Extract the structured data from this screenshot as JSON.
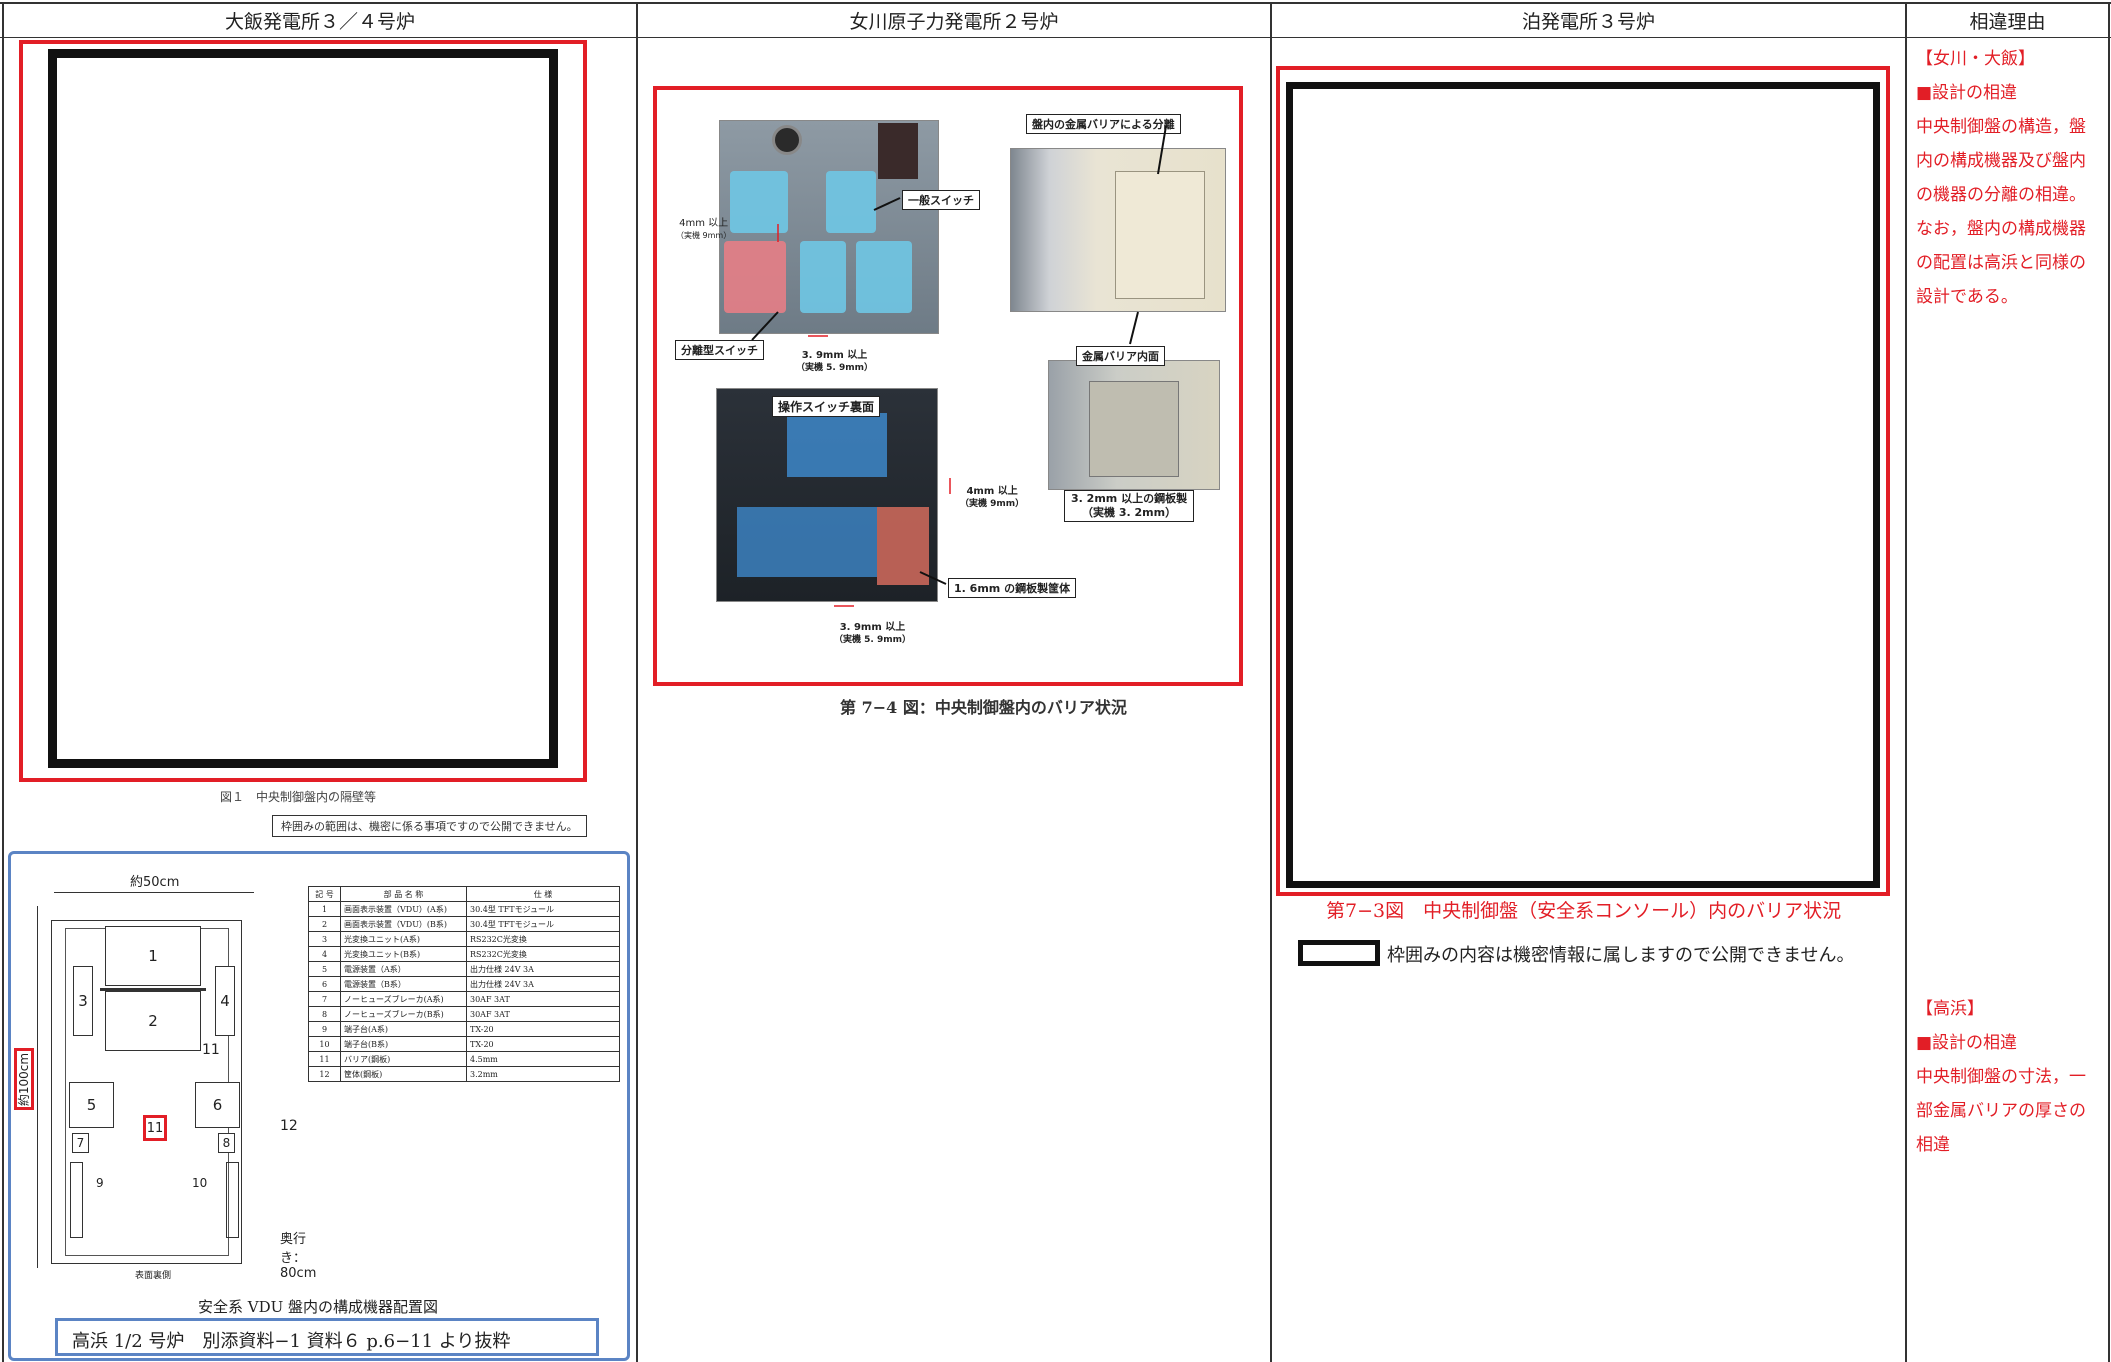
{
  "headers": {
    "col1": "大飯発電所３／４号炉",
    "col2": "女川原子力発電所２号炉",
    "col3": "泊発電所３号炉",
    "col4": "相違理由"
  },
  "col1": {
    "fig1_caption": "図１　中央制御盤内の隔壁等",
    "confidential_note": "枠囲みの範囲は、機密に係る事項ですので公開できません。",
    "layout": {
      "width_label": "約50cm",
      "height_label": "約100cm",
      "depth_label": "奥行き：80cm",
      "front_label": "表面裏側",
      "numbers": [
        "1",
        "2",
        "3",
        "4",
        "5",
        "6",
        "7",
        "8",
        "9",
        "10",
        "11",
        "12"
      ],
      "caption": "安全系 VDU 盤内の構成機器配置図",
      "source": "高浜 1/2 号炉　別添資料−1  資料６ p.6−11 より抜粋"
    },
    "parts_table": {
      "headers": [
        "記 号",
        "部 品 名 称",
        "仕 様"
      ],
      "rows": [
        [
          "1",
          "画面表示装置（VDU）(A系)",
          "30.4型 TFTモジュール"
        ],
        [
          "2",
          "画面表示装置（VDU）(B系)",
          "30.4型 TFTモジュール"
        ],
        [
          "3",
          "光変換ユニット(A系)",
          "RS232C光変換"
        ],
        [
          "4",
          "光変換ユニット(B系)",
          "RS232C光変換"
        ],
        [
          "5",
          "電源装置（A系）",
          "出力仕様 24V 3A"
        ],
        [
          "6",
          "電源装置（B系）",
          "出力仕様 24V 3A"
        ],
        [
          "7",
          "ノーヒューズブレーカ(A系)",
          "30AF 3AT"
        ],
        [
          "8",
          "ノーヒューズブレーカ(B系)",
          "30AF 3AT"
        ],
        [
          "9",
          "端子台(A系)",
          "TX-20"
        ],
        [
          "10",
          "端子台(B系)",
          "TX-20"
        ],
        [
          "11",
          "バリア(鋼板)",
          "4.5mm"
        ],
        [
          "12",
          "筐体(鋼板)",
          "3.2mm"
        ]
      ]
    }
  },
  "col2": {
    "labels": {
      "metal_barrier_separation": "盤内の金属バリアによる分離",
      "general_switch": "一般スイッチ",
      "separate_switch": "分離型スイッチ",
      "metal_barrier_inner": "金属バリア内面",
      "op_switch_back": "操作スイッチ裏面",
      "steel_case": "1. 6mm の鋼板製筐体",
      "steel_plate": "3. 2mm 以上の鋼板製",
      "steel_plate_actual": "（実機 3. 2mm）",
      "gap_4mm": "4mm 以上",
      "gap_4mm_actual": "（実機 9mm）",
      "gap_39": "3. 9mm 以上",
      "gap_39_actual": "（実機 5. 9mm）"
    },
    "caption": "第 7−4 図：中央制御盤内のバリア状況"
  },
  "col3": {
    "caption": "第7−3図　中央制御盤（安全系コンソール）内のバリア状況",
    "confidential_note": "枠囲みの内容は機密情報に属しますので公開できません。"
  },
  "col4": {
    "block1": {
      "title": "【女川・大飯】",
      "item": "■設計の相違",
      "body": "中央制御盤の構造，盤内の構成機器及び盤内の機器の分離の相違。なお，盤内の構成機器の配置は高浜と同様の設計である。"
    },
    "block2": {
      "title": "【高浜】",
      "item": "■設計の相違",
      "body": "中央制御盤の寸法，一部金属バリアの厚さの相違"
    }
  },
  "colors": {
    "red": "#e21e26",
    "blue": "#5b84c4",
    "black": "#111111"
  }
}
